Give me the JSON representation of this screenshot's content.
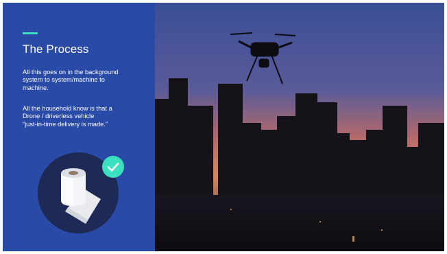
{
  "slide": {
    "title": "The Process",
    "paragraph1": [
      "All this goes on in the background",
      "system to system/machine to",
      "machine."
    ],
    "paragraph2": [
      "All the household know is that a",
      "Drone / driverless vehicle",
      "“just-in-time delivery is made.”"
    ]
  },
  "icons": {
    "product": "toilet-paper-roll-icon",
    "status": "checkmark-icon"
  },
  "colors": {
    "panel": "#2a4aa8",
    "accent": "#39e0c2",
    "icon_circle": "#1d2a55",
    "check": "#3be0c0"
  }
}
